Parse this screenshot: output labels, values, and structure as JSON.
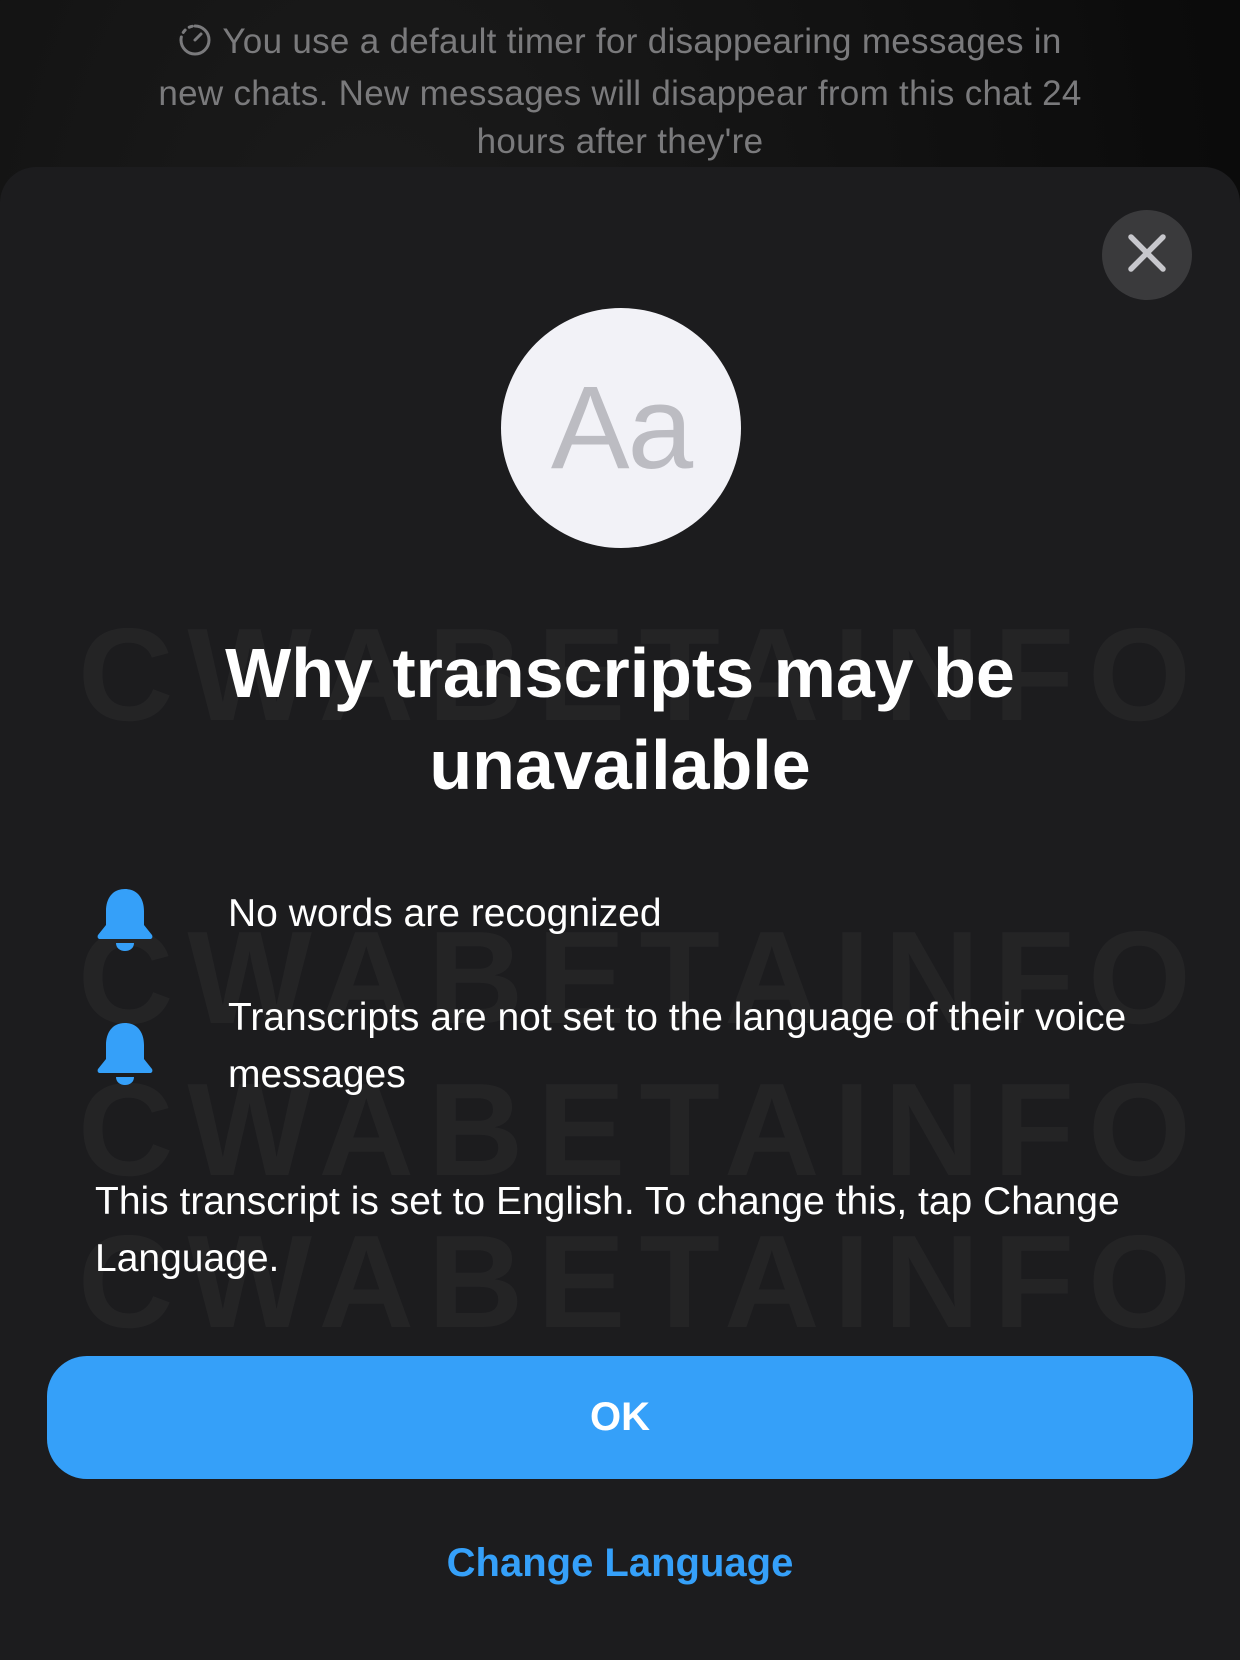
{
  "background_notice": {
    "text": "You use a default timer for disappearing messages in new chats. New messages will disappear from this chat 24 hours after they're",
    "icon": "timer-icon"
  },
  "watermark": "CWABETAINFO",
  "sheet": {
    "close_icon": "close-icon",
    "avatar_text": "Aa",
    "title": "Why transcripts may be unavailable",
    "reasons": [
      {
        "icon": "bell-icon",
        "text": "No words are recognized"
      },
      {
        "icon": "bell-icon",
        "text": "Transcripts are not set to the language of their voice messages"
      }
    ],
    "info_text": "This transcript is set to English. To change this, tap Change Language.",
    "ok_label": "OK",
    "change_language_label": "Change Language"
  },
  "colors": {
    "accent": "#35a0f9",
    "sheet_background": "#1c1c1e",
    "close_button": "#3a3a3c",
    "avatar_background": "#f2f2f7"
  }
}
